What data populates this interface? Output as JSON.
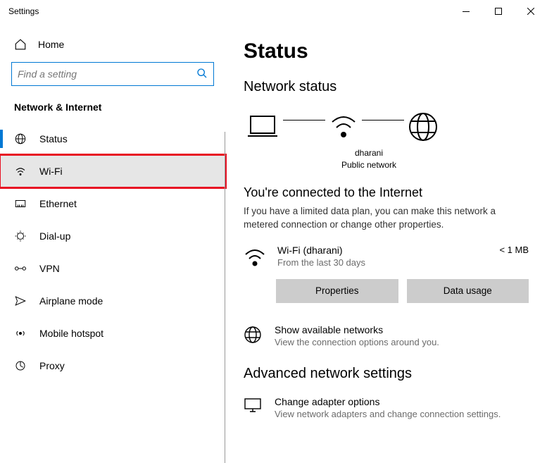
{
  "window": {
    "title": "Settings"
  },
  "sidebar": {
    "home": "Home",
    "search_placeholder": "Find a setting",
    "section": "Network & Internet",
    "items": [
      {
        "label": "Status"
      },
      {
        "label": "Wi-Fi"
      },
      {
        "label": "Ethernet"
      },
      {
        "label": "Dial-up"
      },
      {
        "label": "VPN"
      },
      {
        "label": "Airplane mode"
      },
      {
        "label": "Mobile hotspot"
      },
      {
        "label": "Proxy"
      }
    ]
  },
  "main": {
    "title": "Status",
    "network_status_h": "Network status",
    "diagram": {
      "label1": "dharani",
      "label2": "Public network"
    },
    "connected_h": "You're connected to the Internet",
    "connected_p": "If you have a limited data plan, you can make this network a metered connection or change other properties.",
    "connection": {
      "name": "Wi-Fi (dharani)",
      "sub": "From the last 30 days",
      "usage": "< 1 MB"
    },
    "buttons": {
      "properties": "Properties",
      "data_usage": "Data usage"
    },
    "available": {
      "title": "Show available networks",
      "sub": "View the connection options around you."
    },
    "advanced_h": "Advanced network settings",
    "adapter": {
      "title": "Change adapter options",
      "sub": "View network adapters and change connection settings."
    }
  }
}
